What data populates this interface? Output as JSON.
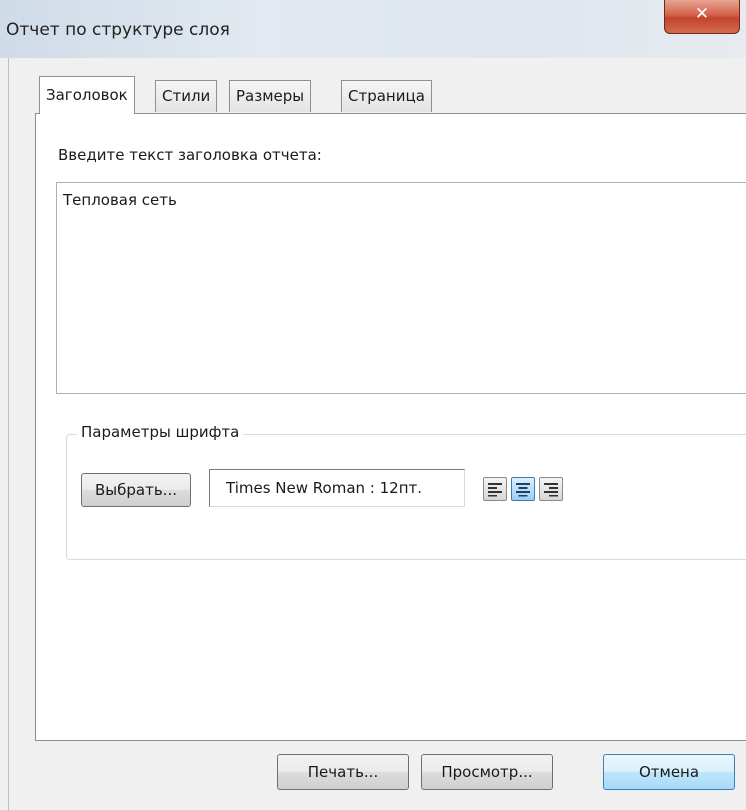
{
  "window": {
    "title": "Отчет по структуре слоя",
    "close_glyph": "✕"
  },
  "tabs": [
    {
      "label": "Заголовок",
      "active": true
    },
    {
      "label": "Стили",
      "active": false
    },
    {
      "label": "Размеры",
      "active": false
    },
    {
      "label": "Страница",
      "active": false
    }
  ],
  "header_tab": {
    "prompt": "Введите текст заголовка отчета:",
    "title_text": "Тепловая сеть"
  },
  "font_params": {
    "legend": "Параметры шрифта",
    "choose_label": "Выбрать...",
    "font_value": "Times New Roman : 12пт.",
    "alignment_options": [
      "align-left-icon",
      "align-center-icon",
      "align-right-icon"
    ],
    "selected_alignment": "align-center-icon"
  },
  "buttons": {
    "print_label": "Печать...",
    "preview_label": "Просмотр...",
    "cancel_label": "Отмена"
  },
  "colors": {
    "focus_accent": "#3c7fb1",
    "close_button": "#c0452c"
  }
}
